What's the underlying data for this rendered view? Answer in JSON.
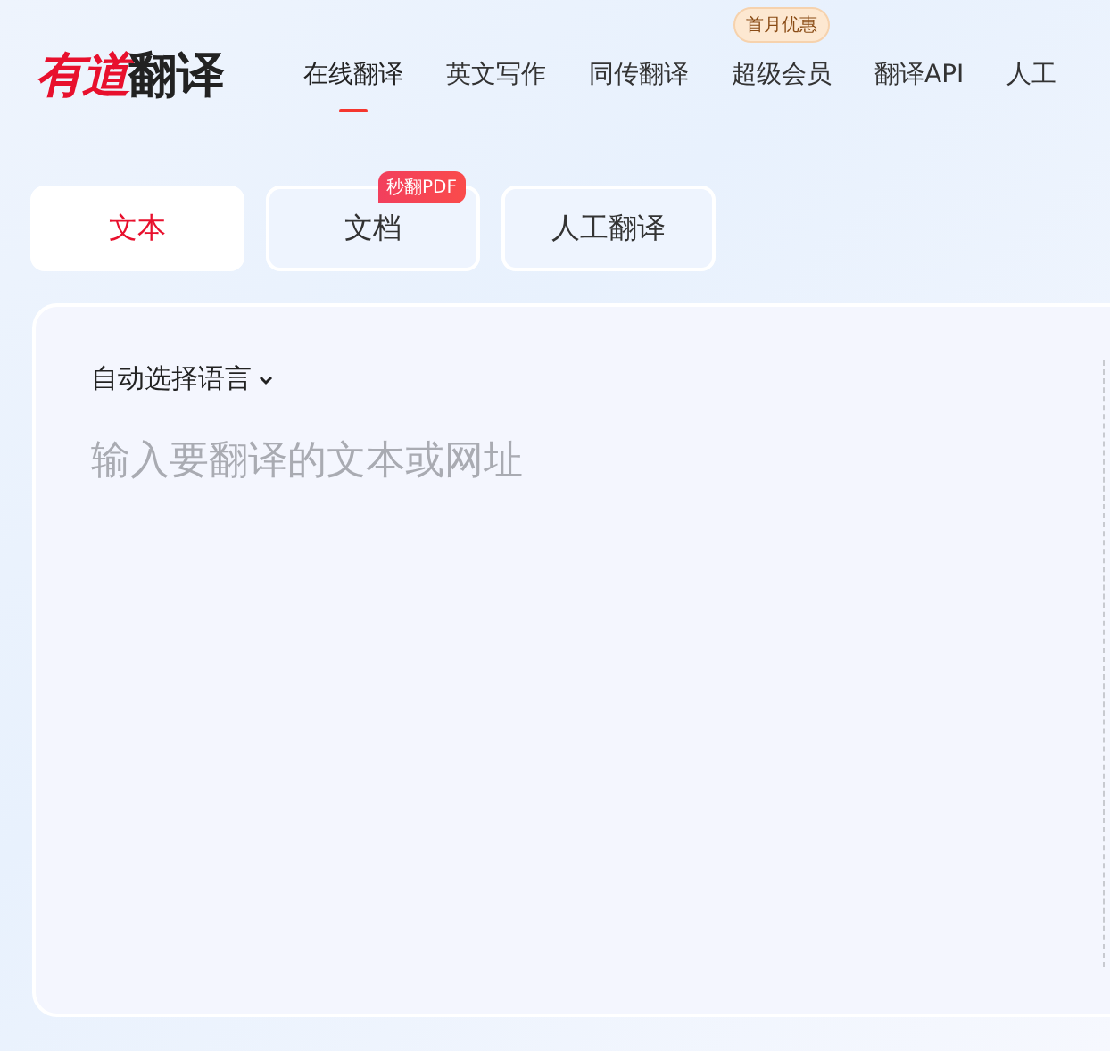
{
  "logo": {
    "brand": "有道",
    "product": "翻译"
  },
  "nav": [
    {
      "label": "在线翻译",
      "selected": true
    },
    {
      "label": "英文写作",
      "selected": false
    },
    {
      "label": "同传翻译",
      "selected": false
    },
    {
      "label": "超级会员",
      "selected": false,
      "badge": "首月优惠"
    },
    {
      "label": "翻译API",
      "selected": false
    },
    {
      "label": "人工",
      "selected": false
    }
  ],
  "tabs": [
    {
      "label": "文本",
      "selected": true
    },
    {
      "label": "文档",
      "selected": false,
      "badge": "秒翻PDF"
    },
    {
      "label": "人工翻译",
      "selected": false
    }
  ],
  "source": {
    "language": "自动选择语言",
    "placeholder": "输入要翻译的文本或网址"
  }
}
